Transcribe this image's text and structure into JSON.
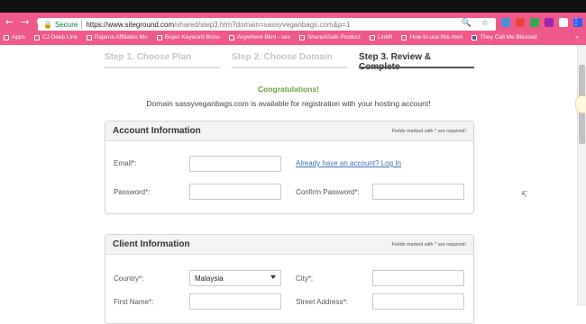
{
  "browser": {
    "nav_back": "←",
    "nav_forward": "→",
    "nav_reload": "C",
    "secure_label": "Secure",
    "url_host": "https://www.siteground.com",
    "url_rest": "/shared/step3.htm?domain=sassyveganbags.com&p=1",
    "omnibox_icons": "🔍 ☆",
    "menu": "⋮",
    "bookmarks": [
      {
        "label": "Apps"
      },
      {
        "label": "CJ Deep Link"
      },
      {
        "label": "Pajama Affiliates Mo"
      },
      {
        "label": "Buyer Keyword Bonu"
      },
      {
        "label": "Anywhere Bknl - sex"
      },
      {
        "label": "ShareASale Product"
      },
      {
        "label": "LinkR"
      },
      {
        "label": "How to use this men"
      },
      {
        "label": "They Call Me Blessed"
      }
    ],
    "bookmarks_more": "»",
    "ext_colors": [
      "#4a90d9",
      "#e8453c",
      "#34a853",
      "#9c27b0",
      "#ffffff",
      "#2962ff",
      "#ffffff"
    ]
  },
  "steps": [
    {
      "label": "Step 1. Choose Plan"
    },
    {
      "label": "Step 2. Choose Domain"
    },
    {
      "label": "Step 3. Review & Complete"
    }
  ],
  "congrats": "Congratulations!",
  "availability": "Domain sassyveganbags.com is available for registration with your hosting account!",
  "account": {
    "title": "Account Information",
    "note": "Fields marked with * are required!",
    "email_label": "Email*:",
    "email_value": "",
    "login_link": "Already have an account? Log In",
    "password_label": "Password*:",
    "password_value": "",
    "confirm_label": "Confirm Password*:",
    "confirm_value": ""
  },
  "client": {
    "title": "Client Information",
    "note": "Fields marked with * are required!",
    "country_label": "Country*:",
    "country_value": "Malaysia",
    "city_label": "City*:",
    "city_value": "",
    "firstname_label": "First Name*:",
    "firstname_value": "",
    "street_label": "Street Address*:",
    "street_value": ""
  },
  "colors": {
    "chrome": "#f05a8a",
    "congrats": "#6aa339",
    "link": "#3a6fb5"
  }
}
